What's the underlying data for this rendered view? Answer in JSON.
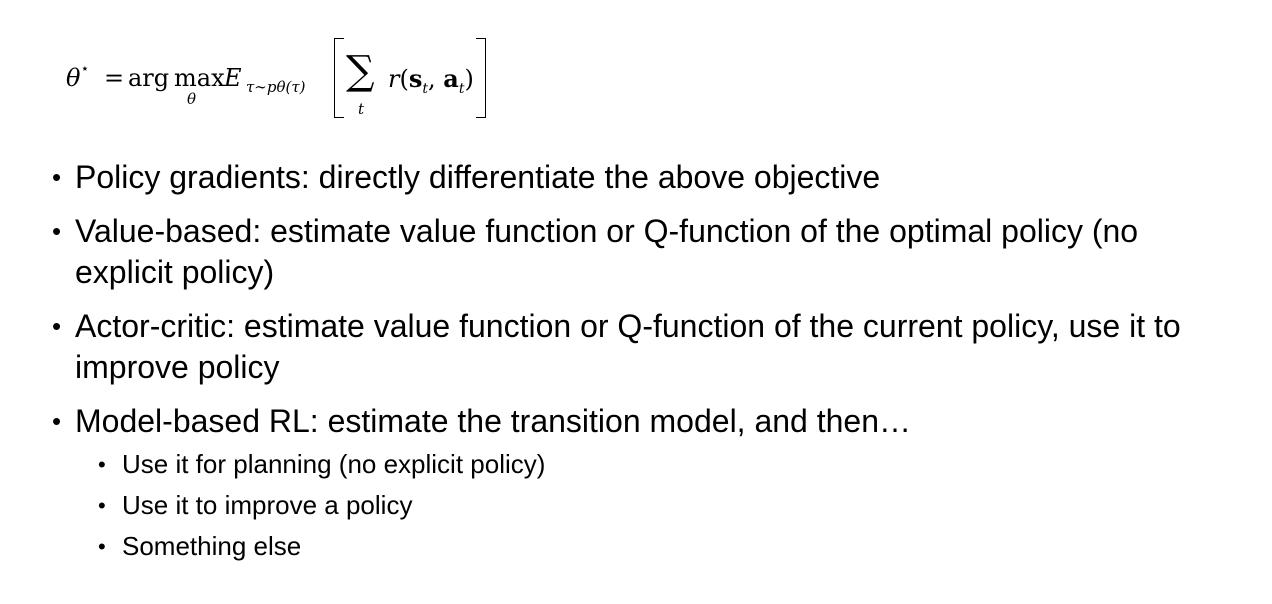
{
  "formula": {
    "theta_star": "θ",
    "star": "⋆",
    "equals": "=",
    "arg": "arg",
    "max": "max",
    "max_sub": "θ",
    "expectation": "E",
    "expectation_sub": "τ∼pθ(τ)",
    "sum": "∑",
    "sum_sub": "t",
    "reward_fn": "r",
    "open_paren": "(",
    "state": "s",
    "state_sub": "t",
    "comma": ",",
    "action": "a",
    "action_sub": "t",
    "close_paren": ")"
  },
  "bullets": [
    {
      "text": "Policy gradients: directly differentiate the above objective"
    },
    {
      "text": "Value-based: estimate value function or Q-function of the optimal policy (no explicit policy)"
    },
    {
      "text": "Actor-critic: estimate value function or Q-function of the current policy, use it to improve policy"
    },
    {
      "text": "Model-based RL: estimate the transition model, and then…",
      "sub": [
        {
          "text": "Use it for planning (no explicit policy)"
        },
        {
          "text": "Use it to improve a policy"
        },
        {
          "text": "Something else"
        }
      ]
    }
  ],
  "bullet_glyph": "•"
}
